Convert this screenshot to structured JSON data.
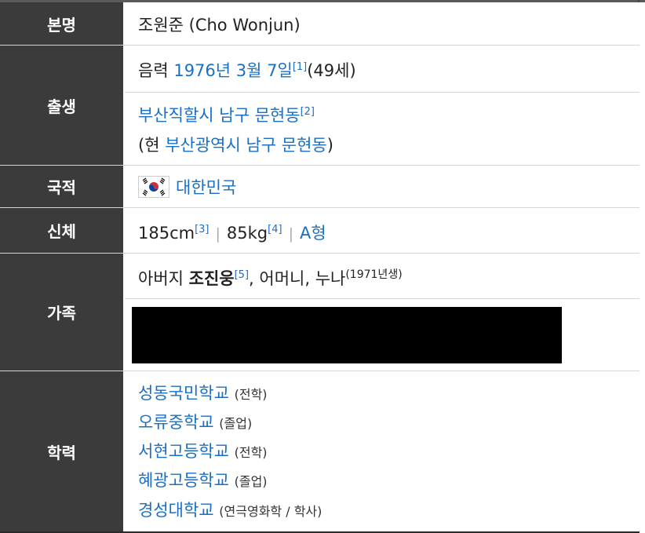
{
  "infobox": {
    "real_name": {
      "label": "본명",
      "value": "조원준 (Cho Wonjun)"
    },
    "birth": {
      "label": "출생",
      "calendar": "음력",
      "date": "1976년 3월 7일",
      "date_ref": "[1]",
      "age": "(49세)",
      "place": "부산직할시 남구 문현동",
      "place_ref": "[2]",
      "current_prefix": "(현 ",
      "current_place": "부산광역시 남구 문현동",
      "current_suffix": ")"
    },
    "nationality": {
      "label": "국적",
      "value": "대한민국",
      "flag_icon": "south-korea-flag-icon"
    },
    "body": {
      "label": "신체",
      "height": "185cm",
      "height_ref": "[3]",
      "separator": "|",
      "weight": "85kg",
      "weight_ref": "[4]",
      "blood_type": "A형"
    },
    "family": {
      "label": "가족",
      "father_prefix": "아버지 ",
      "father_name": "조진웅",
      "father_ref": "[5]",
      "others": ", 어머니, 누나",
      "sister_year": "(1971년생)"
    },
    "education": {
      "label": "학력",
      "schools": [
        {
          "name": "성동국민학교",
          "note": "(전학)"
        },
        {
          "name": "오류중학교",
          "note": "(졸업)"
        },
        {
          "name": "서현고등학교",
          "note": "(전학)"
        },
        {
          "name": "혜광고등학교",
          "note": "(졸업)"
        },
        {
          "name": "경성대학교",
          "note": "(연극영화학 / 학사)"
        }
      ]
    }
  },
  "colors": {
    "header_bg": "#3b3b3b",
    "link": "#1a6fc4",
    "redaction": "#000000"
  }
}
